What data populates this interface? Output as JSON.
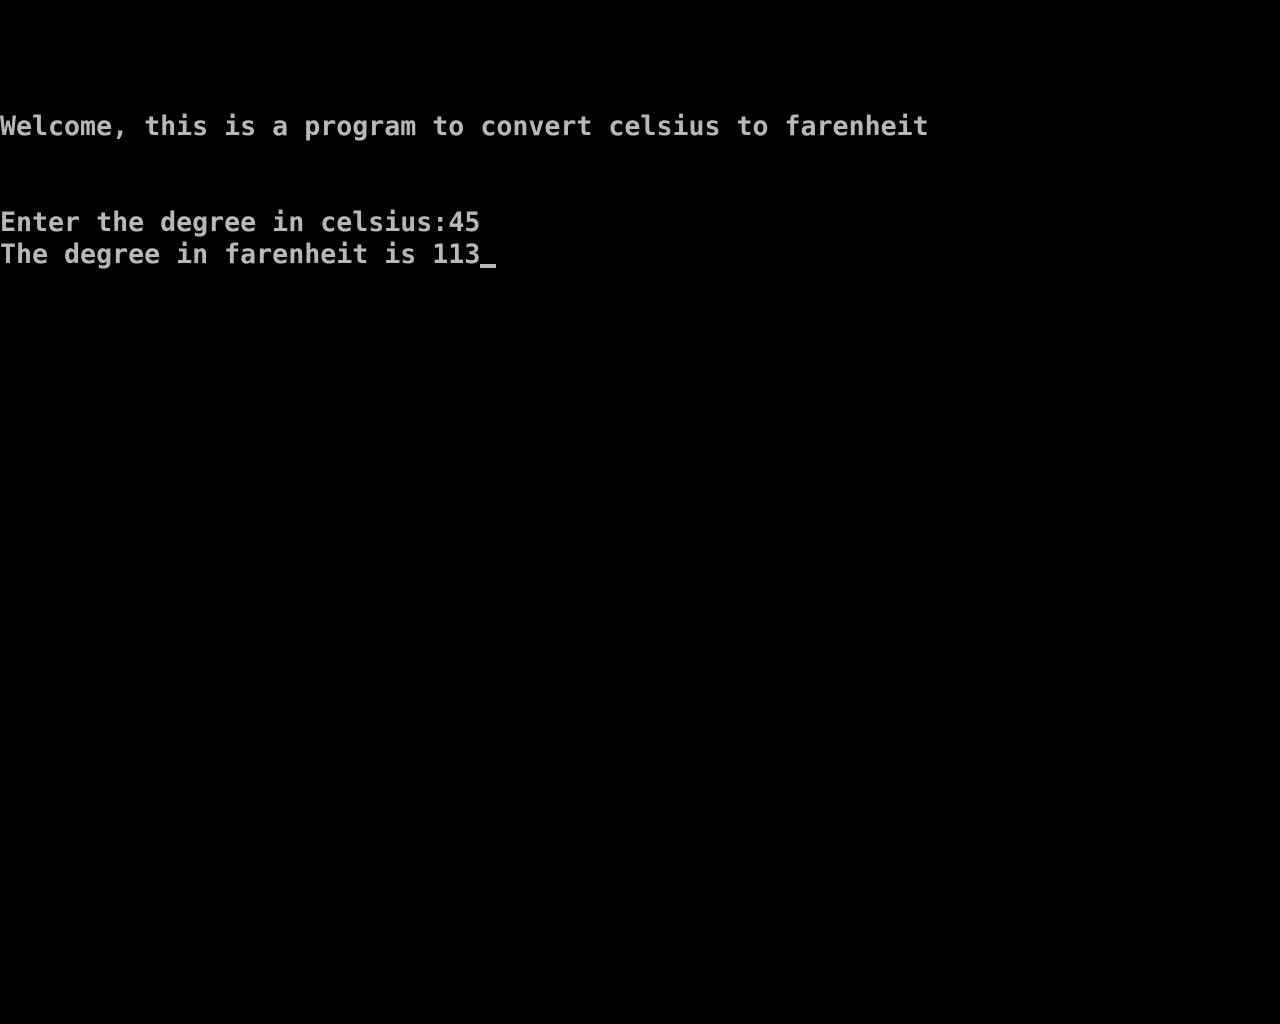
{
  "console": {
    "welcome": "Welcome, this is a program to convert celsius to farenheit",
    "prompt_label": "Enter the degree in celsius:",
    "prompt_value": "45",
    "result_label": "The degree in farenheit is ",
    "result_value": "113",
    "text_color": "#b8b8b8",
    "background": "#000000"
  }
}
